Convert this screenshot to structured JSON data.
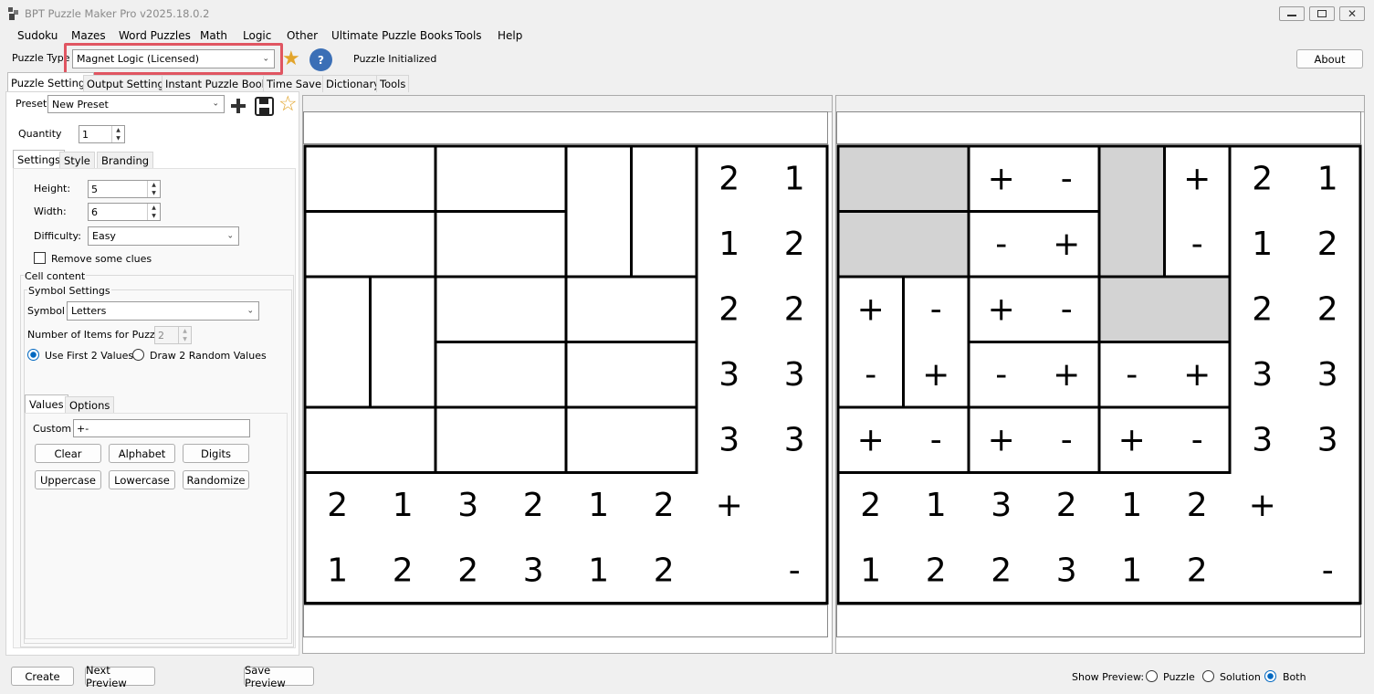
{
  "window": {
    "title": "BPT Puzzle Maker Pro v2025.18.0.2",
    "icons": [
      "app-icon",
      "minimize-icon",
      "maximize-icon",
      "close-icon"
    ]
  },
  "menu": [
    "Sudoku",
    "Mazes",
    "Word Puzzles",
    "Math",
    "Logic",
    "Other",
    "Ultimate Puzzle Books",
    "Tools",
    "Help"
  ],
  "toolbar": {
    "puzzle_type_label": "Puzzle Type",
    "puzzle_type_value": "Magnet Logic (Licensed)",
    "status": "Puzzle Initialized",
    "about_label": "About",
    "highlight_color": "#e05561"
  },
  "main_tabs": [
    "Puzzle Settings",
    "Output Settings",
    "Instant Puzzle Books",
    "Time Saver",
    "Dictionary",
    "Tools"
  ],
  "settings": {
    "preset_label": "Preset",
    "preset_value": "New Preset",
    "quantity_label": "Quantity",
    "quantity_value": "1",
    "sub_tabs": [
      "Settings",
      "Style",
      "Branding"
    ],
    "height_label": "Height:",
    "height_value": "5",
    "width_label": "Width:",
    "width_value": "6",
    "difficulty_label": "Difficulty:",
    "difficulty_value": "Easy",
    "remove_clues_label": "Remove some clues",
    "remove_clues_checked": false,
    "cell_content_label": "Cell content",
    "symbol_settings_label": "Symbol Settings",
    "symbol_label": "Symbol",
    "symbol_value": "Letters",
    "num_items_label": "Number of Items for Puzzle:",
    "num_items_value": "2",
    "radio_first": "Use First 2 Values",
    "radio_random": "Draw 2 Random Values",
    "radio_selected": "first",
    "values_tabs": [
      "Values",
      "Options"
    ],
    "custom_label": "Custom",
    "custom_value": "+-",
    "buttons": [
      "Clear",
      "Alphabet",
      "Digits",
      "Uppercase",
      "Lowercase",
      "Randomize"
    ]
  },
  "puzzle": {
    "rows": 5,
    "cols": 6,
    "row_clues_plus": [
      "2",
      "1",
      "2",
      "3",
      "3"
    ],
    "row_clues_minus": [
      "1",
      "2",
      "2",
      "3",
      "3"
    ],
    "col_clues_plus": [
      "2",
      "1",
      "3",
      "2",
      "1",
      "2"
    ],
    "col_clues_minus": [
      "1",
      "2",
      "2",
      "3",
      "1",
      "2"
    ],
    "plus_symbol": "+",
    "minus_symbol": "-",
    "dominoes": [
      [
        [
          0,
          0
        ],
        [
          0,
          1
        ]
      ],
      [
        [
          0,
          2
        ],
        [
          0,
          3
        ]
      ],
      [
        [
          0,
          4
        ],
        [
          1,
          4
        ]
      ],
      [
        [
          0,
          5
        ],
        [
          1,
          5
        ]
      ],
      [
        [
          1,
          0
        ],
        [
          1,
          1
        ]
      ],
      [
        [
          1,
          2
        ],
        [
          1,
          3
        ]
      ],
      [
        [
          2,
          0
        ],
        [
          3,
          0
        ]
      ],
      [
        [
          2,
          1
        ],
        [
          3,
          1
        ]
      ],
      [
        [
          2,
          2
        ],
        [
          2,
          3
        ]
      ],
      [
        [
          2,
          4
        ],
        [
          2,
          5
        ]
      ],
      [
        [
          3,
          2
        ],
        [
          3,
          3
        ]
      ],
      [
        [
          3,
          4
        ],
        [
          3,
          5
        ]
      ],
      [
        [
          4,
          0
        ],
        [
          4,
          1
        ]
      ],
      [
        [
          4,
          2
        ],
        [
          4,
          3
        ]
      ],
      [
        [
          4,
          4
        ],
        [
          4,
          5
        ]
      ]
    ],
    "solution": [
      [
        "",
        "",
        "+",
        "-",
        "",
        "+"
      ],
      [
        "",
        "",
        "-",
        "+",
        "",
        "-"
      ],
      [
        "+",
        "-",
        "+",
        "-",
        "",
        ""
      ],
      [
        "-",
        "+",
        "-",
        "+",
        "-",
        "+"
      ],
      [
        "+",
        "-",
        "+",
        "-",
        "+",
        "-"
      ]
    ],
    "neutral_color": "#d3d3d3"
  },
  "bottom": {
    "create_label": "Create",
    "next_preview_label": "Next Preview",
    "save_preview_label": "Save Preview",
    "show_preview_label": "Show Preview:",
    "options": [
      "Puzzle",
      "Solution",
      "Both"
    ],
    "selected": "Both"
  }
}
